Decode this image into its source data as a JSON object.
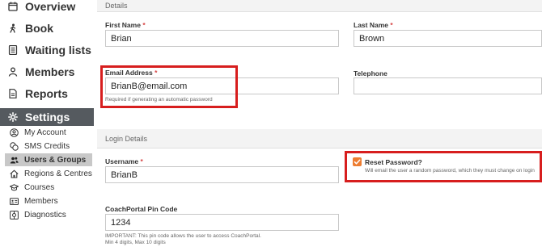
{
  "sidebar": {
    "items": [
      {
        "label": "Overview",
        "icon": "calendar-icon"
      },
      {
        "label": "Book",
        "icon": "person-walking-icon"
      },
      {
        "label": "Waiting lists",
        "icon": "list-icon"
      },
      {
        "label": "Members",
        "icon": "person-icon"
      },
      {
        "label": "Reports",
        "icon": "document-icon"
      },
      {
        "label": "Settings",
        "icon": "gear-icon",
        "active": true
      }
    ],
    "sub_items": [
      {
        "label": "My Account",
        "icon": "user-circle-icon"
      },
      {
        "label": "SMS Credits",
        "icon": "coins-icon"
      },
      {
        "label": "Users & Groups",
        "icon": "users-icon",
        "active": true
      },
      {
        "label": "Regions & Centres",
        "icon": "home-icon"
      },
      {
        "label": "Courses",
        "icon": "graduation-cap-icon"
      },
      {
        "label": "Members",
        "icon": "address-card-icon"
      },
      {
        "label": "Diagnostics",
        "icon": "diagnostics-icon"
      }
    ]
  },
  "details": {
    "heading": "Details",
    "first_name_label": "First Name",
    "first_name_value": "Brian",
    "last_name_label": "Last Name",
    "last_name_value": "Brown",
    "email_label": "Email Address",
    "email_value": "BrianB@email.com",
    "email_help": "Required if generating an automatic password",
    "telephone_label": "Telephone",
    "telephone_value": ""
  },
  "login": {
    "heading": "Login Details",
    "username_label": "Username",
    "username_value": "BrianB",
    "reset_label": "Reset Password?",
    "reset_checked": true,
    "reset_help": "Will email the user a random password, which they must change on login",
    "pin_label": "CoachPortal Pin Code",
    "pin_value": "1234",
    "pin_help_1": "IMPORTANT: This pin code allows the user to access CoachPortal.",
    "pin_help_2": "Min 4 digits, Max 10 digits"
  },
  "required_marker": "*",
  "colors": {
    "highlight": "#d71e1e",
    "accent_orange": "#ed7d31",
    "active_nav": "#555a5f",
    "required": "#d64545"
  }
}
